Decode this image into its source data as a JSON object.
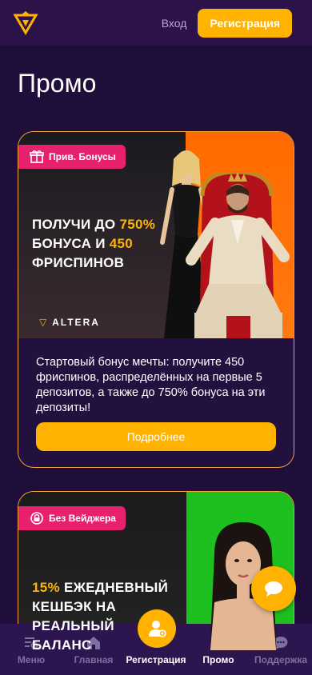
{
  "header": {
    "login_label": "Вход",
    "register_label": "Регистрация"
  },
  "page_title": "Промо",
  "promos": [
    {
      "badge": "Прив. Бонусы",
      "headline_pre": "ПОЛУЧИ ДО ",
      "headline_hl1": "750%",
      "headline_mid": " БОНУСА И ",
      "headline_hl2": "450",
      "headline_post": " ФРИСПИНОВ",
      "brand": "ALTERA",
      "description": "Стартовый бонус мечты: получите 450 фриспинов, распределённых на первые 5 депозитов, а также до 750% бонуса на эти депозиты!",
      "button_label": "Подробнее"
    },
    {
      "badge": "Без Вейджера",
      "headline_hl": "15%",
      "headline_rest": " ЕЖЕДНЕВНЫЙ КЕШБЭК НА РЕАЛЬНЫЙ БАЛАНС"
    }
  ],
  "bottom_nav": {
    "items": [
      {
        "label": "Меню",
        "icon": "menu-icon"
      },
      {
        "label": "Главная",
        "icon": "home-icon"
      },
      {
        "label": "Регистрация",
        "icon": "user-add-icon"
      },
      {
        "label": "Промо",
        "icon": "money-bag-icon"
      },
      {
        "label": "Поддержка",
        "icon": "chat-icon"
      }
    ]
  },
  "colors": {
    "accent": "#ffb300",
    "background": "#1f0d3a",
    "badge": "#e8216f",
    "card_border": "#f2a33a"
  }
}
